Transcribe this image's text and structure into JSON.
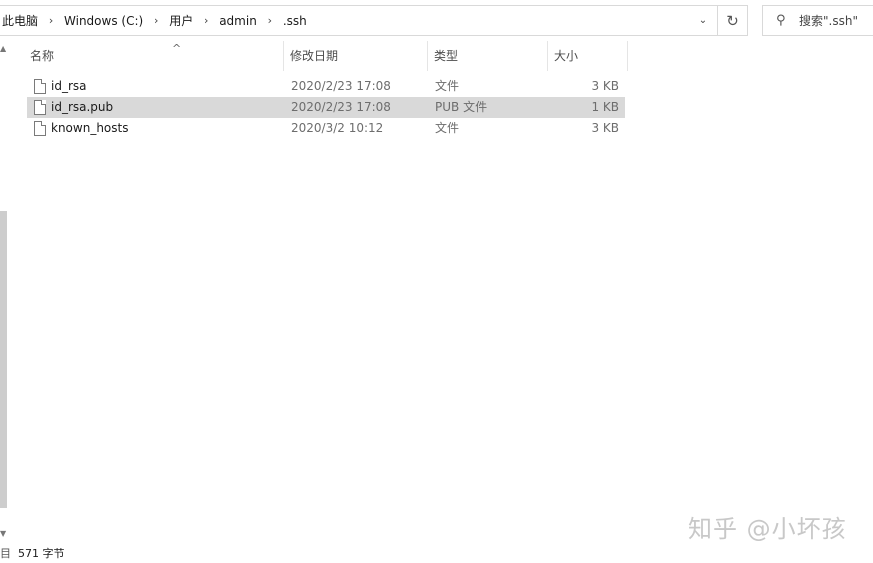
{
  "address": {
    "crumbs": [
      "此电脑",
      "Windows (C:)",
      "用户",
      "admin",
      ".ssh"
    ],
    "separator": "›",
    "dropdown_glyph": "⌄",
    "refresh_glyph": "↻"
  },
  "search": {
    "placeholder": "搜索\".ssh\"",
    "icon": "search-icon",
    "icon_glyph": "⚲"
  },
  "columns": {
    "name": "名称",
    "date": "修改日期",
    "type": "类型",
    "size": "大小",
    "sort_glyph": "^"
  },
  "files": [
    {
      "name": "id_rsa",
      "date": "2020/2/23 17:08",
      "type": "文件",
      "size": "3 KB",
      "selected": false
    },
    {
      "name": "id_rsa.pub",
      "date": "2020/2/23 17:08",
      "type": "PUB 文件",
      "size": "1 KB",
      "selected": true
    },
    {
      "name": "known_hosts",
      "date": "2020/3/2 10:12",
      "type": "文件",
      "size": "3 KB",
      "selected": false
    }
  ],
  "status": {
    "glyph": "目",
    "text": "571 字节"
  },
  "scrollbar": {
    "up_glyph": "▲",
    "down_glyph": "▼"
  },
  "watermark": "知乎 @小坏孩"
}
